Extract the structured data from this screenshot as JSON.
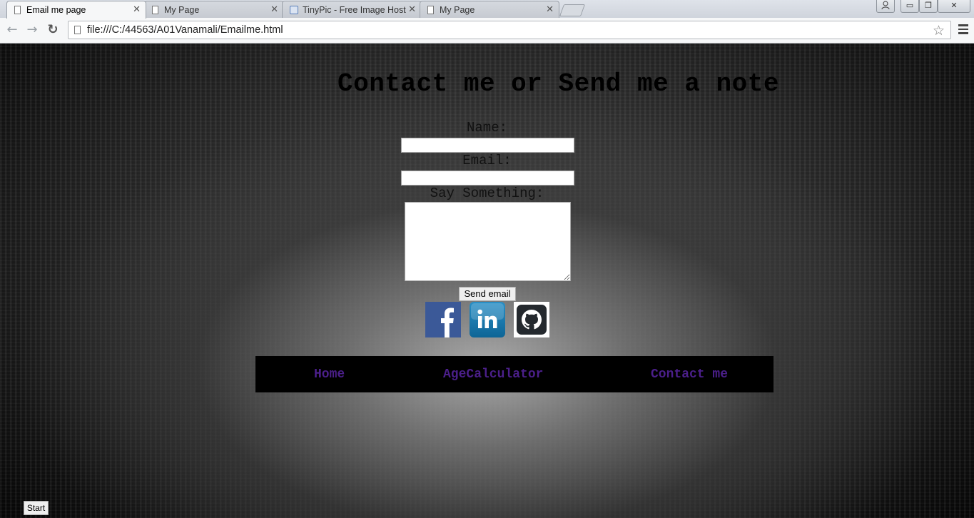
{
  "browser": {
    "tabs": [
      {
        "title": "Email me page",
        "active": true
      },
      {
        "title": "My Page",
        "active": false
      },
      {
        "title": "TinyPic - Free Image Host",
        "active": false
      },
      {
        "title": "My Page",
        "active": false
      }
    ],
    "close_glyph": "✕",
    "url": "file:///C:/44563/A01Vanamali/Emailme.html",
    "window_buttons": {
      "minimize": "▭",
      "restore": "❐",
      "close": "✕"
    }
  },
  "page": {
    "title": "Contact me or Send me a note",
    "form": {
      "name_label": "Name:",
      "name_value": "",
      "email_label": "Email:",
      "email_value": "",
      "message_label": "Say Something:",
      "message_value": "",
      "submit_label": "Send email"
    },
    "social": [
      {
        "icon": "facebook-icon",
        "color": "#3b5998"
      },
      {
        "icon": "linkedin-icon",
        "color": "#0e76a8"
      },
      {
        "icon": "github-icon",
        "color": "#24292e"
      }
    ],
    "nav": {
      "links": [
        "Home",
        "AgeCalculator",
        "Contact me"
      ],
      "color": "#4b1f8a"
    },
    "start_label": "Start"
  }
}
